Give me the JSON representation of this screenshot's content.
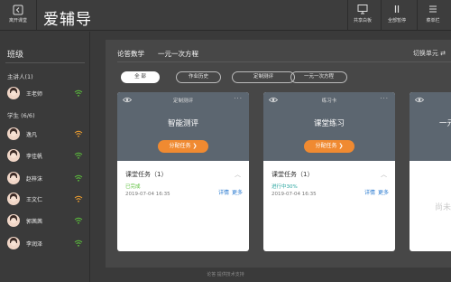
{
  "app": {
    "title": "爱辅导"
  },
  "topbar": {
    "exit_label": "离开课堂",
    "buttons": [
      {
        "label": "共享白板",
        "icon": "monitor-icon"
      },
      {
        "label": "全部暂停",
        "icon": "pause-icon"
      },
      {
        "label": "菜单栏",
        "icon": "menu-icon"
      }
    ]
  },
  "sidebar": {
    "title": "班级",
    "teacher_section": "主讲人(1)",
    "teacher": {
      "name": "王老师",
      "signal_color": "#5cc03c"
    },
    "student_section": "学生 (6/6)",
    "students": [
      {
        "name": "逸凡",
        "signal_color": "#f0a030"
      },
      {
        "name": "李佳帆",
        "signal_color": "#5cc03c"
      },
      {
        "name": "赵梓沫",
        "signal_color": "#5cc03c"
      },
      {
        "name": "王文仁",
        "signal_color": "#f0a030"
      },
      {
        "name": "郭茜茜",
        "signal_color": "#5cc03c"
      },
      {
        "name": "李润泽",
        "signal_color": "#5cc03c"
      }
    ]
  },
  "main": {
    "course": "论答数学",
    "topic": "一元一次方程",
    "switch_label": "切换单元 ⇄",
    "tabs": [
      "全 部",
      "作业历史",
      "定制测评",
      "一元一次方程"
    ],
    "cards": [
      {
        "kind": "定制测评",
        "name": "智能测评",
        "assign": "分配任务 ❯",
        "task": "课堂任务（1）",
        "status": "已完成",
        "status_color": "#5cc03c",
        "date": "2019-07-04 16:35",
        "detail": "详情",
        "more": "更多"
      },
      {
        "kind": "练习卡",
        "name": "课堂练习",
        "assign": "分配任务 ❯",
        "task": "课堂任务（1）",
        "status": "进行中30%",
        "status_color": "#2aa6a0",
        "date": "2019-07-04 16:35",
        "detail": "详情",
        "more": "更多"
      }
    ],
    "partial_card": {
      "name": "一元",
      "empty": "尚未"
    }
  },
  "footer": "论答 提供技术支持",
  "colors": {
    "accent": "#f08a31",
    "card_header": "#5c6670",
    "link": "#2b7bd0"
  }
}
